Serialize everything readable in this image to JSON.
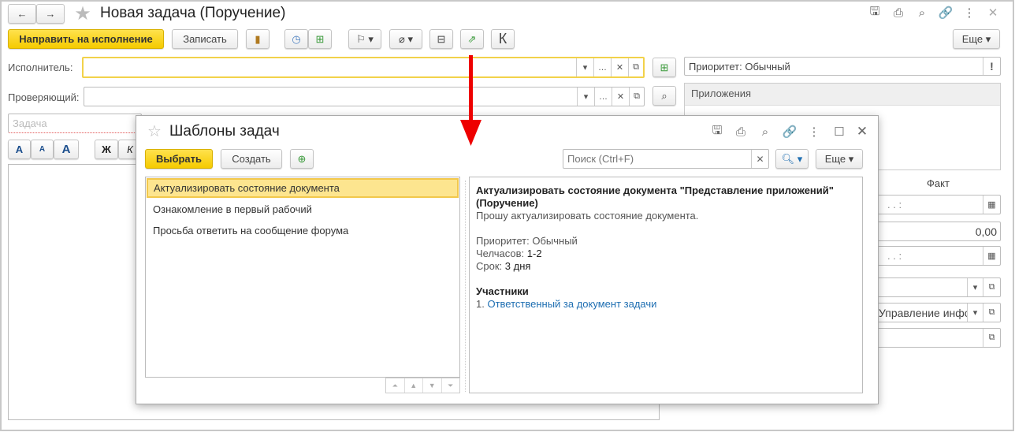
{
  "window": {
    "title": "Новая задача (Поручение)",
    "back": "←",
    "forward": "→"
  },
  "toolbar": {
    "send": "Направить на исполнение",
    "save": "Записать",
    "k": "К",
    "more": "Еще"
  },
  "form": {
    "performer_label": "Исполнитель:",
    "performer_value": "",
    "reviewer_label": "Проверяющий:",
    "reviewer_value": "",
    "task_placeholder": "Задача",
    "bold": "Ж",
    "italic": "К",
    "font_up": "A",
    "font_down": "A",
    "font": "A"
  },
  "right": {
    "priority": "Приоритет: Обычный",
    "attachments_title": "Приложения",
    "fact_label": "Факт",
    "date1": ". .    :",
    "amount": "0,00",
    "date2": ". .    :",
    "project": "Управление инфо"
  },
  "dialog": {
    "title": "Шаблоны задач",
    "select": "Выбрать",
    "create": "Создать",
    "search_placeholder": "Поиск (Ctrl+F)",
    "more": "Еще",
    "templates": [
      "Актуализировать состояние документа",
      "Ознакомление в первый рабочий",
      "Просьба ответить на сообщение форума"
    ],
    "selected_index": 0,
    "detail": {
      "heading": "Актуализировать состояние документа \"Представление приложений\" (Поручение)",
      "description": "Прошу актуализировать состояние документа.",
      "priority": "Приоритет: Обычный",
      "hours_label": "Челчасов:",
      "hours": "1-2",
      "deadline_label": "Срок:",
      "deadline": "3 дня",
      "participants_title": "Участники",
      "participant_num": "1.",
      "participant": "Ответственный за документ задачи"
    }
  },
  "colors": {
    "accent": "#f5cb00",
    "selection": "#fde58f",
    "link": "#1f6fb2",
    "arrow": "#ee0000"
  }
}
